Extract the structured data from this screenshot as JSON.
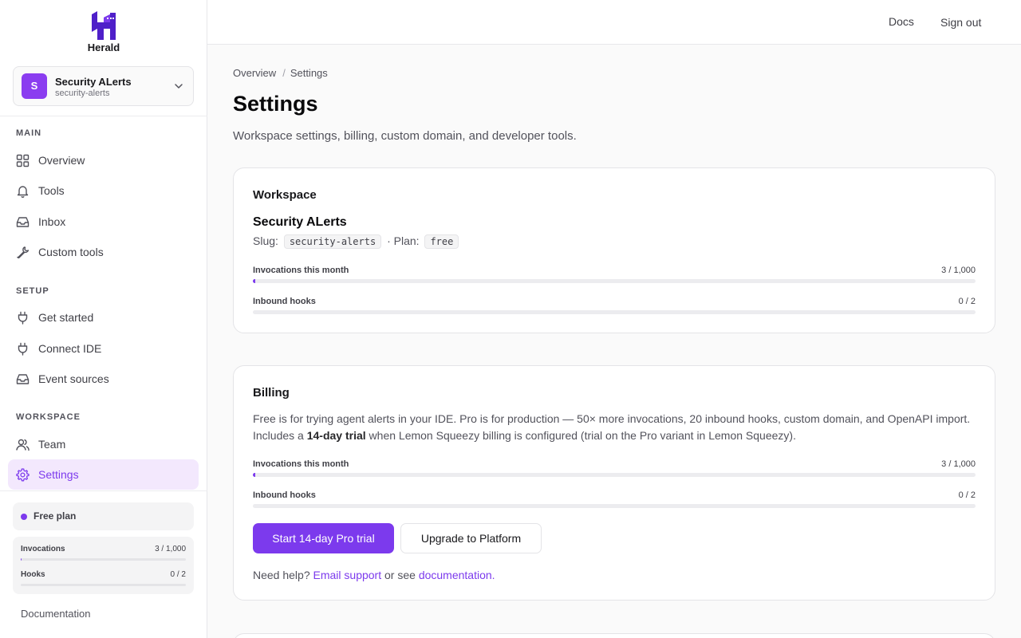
{
  "brand": {
    "name": "Herald",
    "color": "#4f1fc9"
  },
  "workspace_switcher": {
    "avatar": "S",
    "name": "Security ALerts",
    "slug": "security-alerts"
  },
  "sidebar": {
    "sections": [
      {
        "label": "MAIN",
        "items": [
          {
            "label": "Overview",
            "icon": "grid-icon"
          },
          {
            "label": "Tools",
            "icon": "bell-icon"
          },
          {
            "label": "Inbox",
            "icon": "inbox-icon"
          },
          {
            "label": "Custom tools",
            "icon": "wrench-icon"
          }
        ]
      },
      {
        "label": "SETUP",
        "items": [
          {
            "label": "Get started",
            "icon": "plug-icon"
          },
          {
            "label": "Connect IDE",
            "icon": "plug-icon"
          },
          {
            "label": "Event sources",
            "icon": "inbox-icon"
          }
        ]
      },
      {
        "label": "WORKSPACE",
        "items": [
          {
            "label": "Team",
            "icon": "users-icon"
          },
          {
            "label": "Settings",
            "icon": "gear-icon",
            "active": true
          }
        ]
      }
    ],
    "plan": "Free plan",
    "usage": [
      {
        "label": "Invocations",
        "value": "3 / 1,000",
        "fraction": 0.003
      },
      {
        "label": "Hooks",
        "value": "0 / 2",
        "fraction": 0
      }
    ],
    "documentation": "Documentation"
  },
  "topbar": {
    "docs": "Docs",
    "sign_out": "Sign out"
  },
  "breadcrumb": {
    "first": "Overview",
    "sep": "/",
    "current": "Settings"
  },
  "page": {
    "title": "Settings",
    "subtitle": "Workspace settings, billing, custom domain, and developer tools."
  },
  "workspace_card": {
    "heading": "Workspace",
    "name": "Security ALerts",
    "slug_label": "Slug:",
    "slug": "security-alerts",
    "plan_sep": "· Plan:",
    "plan": "free",
    "metrics": [
      {
        "label": "Invocations this month",
        "value": "3 / 1,000",
        "fraction": 0.003
      },
      {
        "label": "Inbound hooks",
        "value": "0 / 2",
        "fraction": 0
      }
    ]
  },
  "billing_card": {
    "heading": "Billing",
    "desc_before": "Free is for trying agent alerts in your IDE. Pro is for production — 50× more invocations, 20 inbound hooks, custom domain, and OpenAPI import. Includes a ",
    "desc_bold": "14-day trial",
    "desc_after": " when Lemon Squeezy billing is configured (trial on the Pro variant in Lemon Squeezy).",
    "metrics": [
      {
        "label": "Invocations this month",
        "value": "3 / 1,000",
        "fraction": 0.003
      },
      {
        "label": "Inbound hooks",
        "value": "0 / 2",
        "fraction": 0
      }
    ],
    "primary_button": "Start 14-day Pro trial",
    "secondary_button": "Upgrade to Platform",
    "help_prefix": "Need help?",
    "help_email": "Email support",
    "help_mid": "or see",
    "help_docs": "documentation."
  },
  "colors": {
    "accent": "#7c3aed",
    "active_bg": "#f3e8fd"
  }
}
